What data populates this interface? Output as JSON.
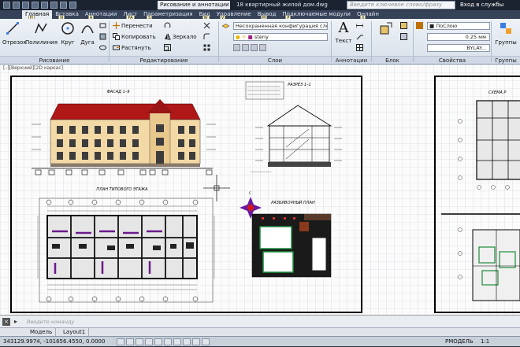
{
  "titlebar": {
    "workspace": "Рисование и аннотации",
    "document": "18 квартирный жилой дом.dwg",
    "search_placeholder": "Введите ключевое слово/фразу",
    "login": "Вход в службы"
  },
  "tabs": [
    {
      "label": "Главная",
      "key": "H"
    },
    {
      "label": "Вставка",
      "key": "N"
    },
    {
      "label": "Аннотации",
      "key": "A"
    },
    {
      "label": "Лист",
      "key": "PA"
    },
    {
      "label": "Параметризация",
      "key": "S"
    },
    {
      "label": "Вид",
      "key": "W"
    },
    {
      "label": "Управление",
      "key": "V"
    },
    {
      "label": "Вывод",
      "key": "M"
    },
    {
      "label": "Подключаемые модули",
      "key": "P"
    },
    {
      "label": "Онлайн",
      "key": "X"
    }
  ],
  "ribbon": {
    "draw": {
      "line": "Отрезок",
      "polyline": "Полилиния",
      "circle": "Круг",
      "arc": "Дуга",
      "panel": "Рисование"
    },
    "modify": {
      "move": "Перенести",
      "copy": "Копировать",
      "stretch": "Растянуть",
      "mirror": "Зеркало",
      "panel": "Редактирование"
    },
    "layers": {
      "config": "Несохраненная конфигурация сло",
      "layer": "steny",
      "panel": "Слои"
    },
    "annotation": {
      "text": "Текст",
      "panel": "Аннотации"
    },
    "block": {
      "insert": "Вставить",
      "panel": "Блок"
    },
    "properties": {
      "color": "ПоСлою",
      "lineweight": "0.25 мм",
      "linetype": "BYLAY...",
      "panel": "Свойства"
    },
    "groups": {
      "label": "Группы",
      "panel": "Группы"
    }
  },
  "canvas": {
    "viewport_label": "[–][Верхний][2D каркас]",
    "facade_title": "ФАСАД 1–9",
    "section_title": "РАЗРЕЗ 1–1",
    "plan_title": "ПЛАН ТИПОВОГО ЭТАЖА",
    "detail_title": "РАЗБИВОЧНЫЙ ПЛАН",
    "scheme_title": "СХЕМА Р"
  },
  "command": {
    "placeholder": "Введите команду"
  },
  "layouts": {
    "model": "Модель",
    "layout1": "Layout1"
  },
  "status": {
    "coords": "343129.9974, -101656.4550, 0.0000",
    "model": "РМОДЕЛЬ",
    "scale": "1:1"
  }
}
